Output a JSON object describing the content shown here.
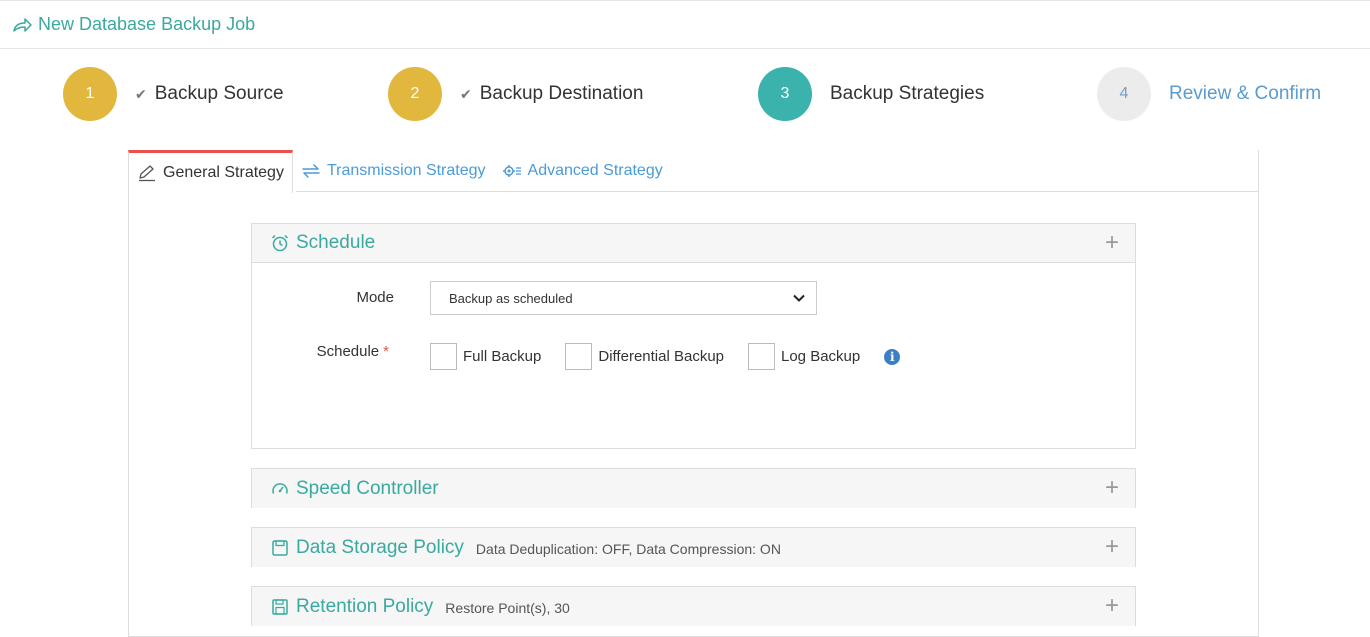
{
  "header": {
    "title": "New Database Backup Job"
  },
  "steps": [
    {
      "number": "1",
      "label": "Backup Source",
      "status": "done"
    },
    {
      "number": "2",
      "label": "Backup Destination",
      "status": "done"
    },
    {
      "number": "3",
      "label": "Backup Strategies",
      "status": "active"
    },
    {
      "number": "4",
      "label": "Review & Confirm",
      "status": "pending"
    }
  ],
  "tabs": [
    {
      "label": "General Strategy",
      "icon": "pencil-icon",
      "active": true
    },
    {
      "label": "Transmission Strategy",
      "icon": "arrows-exchange-icon",
      "active": false
    },
    {
      "label": "Advanced Strategy",
      "icon": "gear-list-icon",
      "active": false
    }
  ],
  "schedule": {
    "title": "Schedule",
    "mode_label": "Mode",
    "mode_value": "Backup as scheduled",
    "schedule_label": "Schedule",
    "required_mark": "*",
    "options": [
      "Full Backup",
      "Differential Backup",
      "Log Backup"
    ]
  },
  "speed": {
    "title": "Speed Controller"
  },
  "storage": {
    "title": "Data Storage Policy",
    "summary": "Data Deduplication: OFF, Data Compression: ON"
  },
  "retention": {
    "title": "Retention Policy",
    "summary": "Restore Point(s), 30"
  },
  "colors": {
    "accent": "#3aa99f",
    "done": "#e2b73e",
    "active": "#3bb3ac",
    "link": "#4b9bd6",
    "tab_top": "#e9524c"
  }
}
